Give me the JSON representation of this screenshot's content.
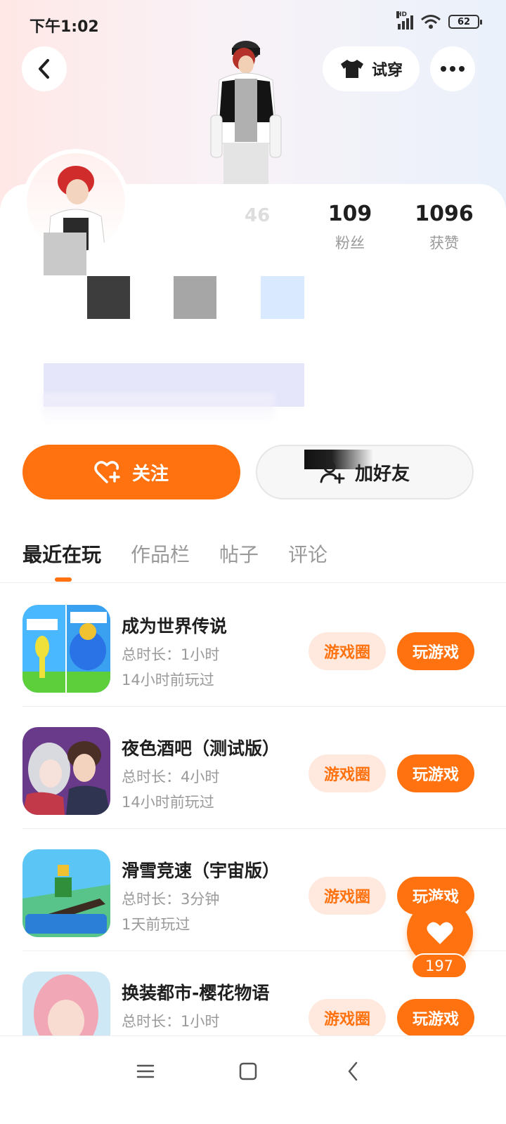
{
  "status_bar": {
    "time": "下午1:02",
    "network_badge": "HD",
    "battery": "62"
  },
  "top_bar": {
    "try_on_label": "试穿"
  },
  "profile": {
    "id_fragment": "46",
    "stats": [
      {
        "value": "109",
        "label": "粉丝"
      },
      {
        "value": "1096",
        "label": "获赞"
      }
    ]
  },
  "actions": {
    "follow_label": "关注",
    "add_friend_label": "加好友"
  },
  "tabs": [
    "最近在玩",
    "作品栏",
    "帖子",
    "评论"
  ],
  "games": [
    {
      "title": "成为世界传说",
      "duration": "总时长：1小时",
      "played": "14小时前玩过",
      "circle_label": "游戏圈",
      "play_label": "玩游戏",
      "icon": "level-game-icon"
    },
    {
      "title": "夜色酒吧（测试版）",
      "duration": "总时长：4小时",
      "played": "14小时前玩过",
      "circle_label": "游戏圈",
      "play_label": "玩游戏",
      "icon": "bar-game-icon"
    },
    {
      "title": "滑雪竞速（宇宙版）",
      "duration": "总时长：3分钟",
      "played": "1天前玩过",
      "circle_label": "游戏圈",
      "play_label": "玩游戏",
      "icon": "ski-game-icon"
    },
    {
      "title": "换装都市-樱花物语",
      "duration": "总时长：1小时",
      "played": "",
      "circle_label": "游戏圈",
      "play_label": "玩游戏",
      "icon": "dressup-game-icon"
    }
  ],
  "like": {
    "count": "197"
  },
  "colors": {
    "accent": "#ff720f",
    "accent_light": "#ffe9de"
  }
}
